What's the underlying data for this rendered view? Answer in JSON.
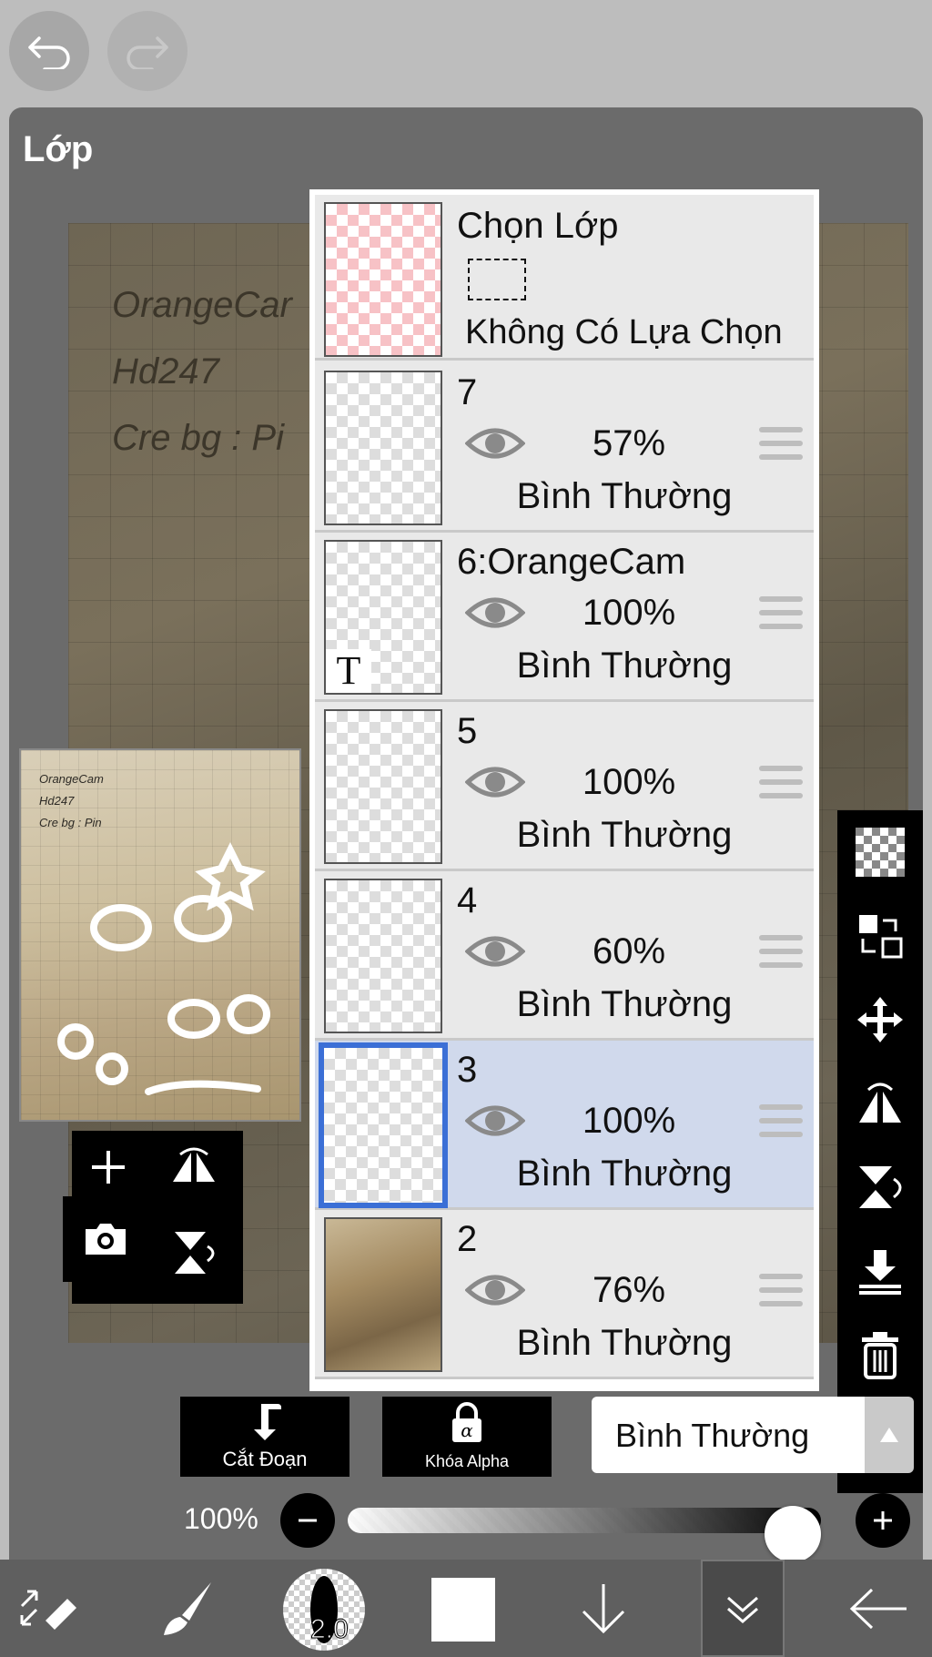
{
  "panel": {
    "title": "Lớp"
  },
  "canvas": {
    "lines": [
      "OrangeCar",
      "Hd247",
      "Cre bg : Pi"
    ]
  },
  "preview": {
    "lines": [
      "OrangeCam",
      "Hd247",
      "Cre bg : Pin"
    ]
  },
  "selection_layer": {
    "title": "Chọn Lớp",
    "status": "Không Có Lựa Chọn"
  },
  "layers": [
    {
      "name": "7",
      "opacity": "57%",
      "blend": "Bình Thường",
      "selected": false
    },
    {
      "name": "6:OrangeCam",
      "opacity": "100%",
      "blend": "Bình Thường",
      "selected": false,
      "thumb_letter": "T"
    },
    {
      "name": "5",
      "opacity": "100%",
      "blend": "Bình Thường",
      "selected": false
    },
    {
      "name": "4",
      "opacity": "60%",
      "blend": "Bình Thường",
      "selected": false
    },
    {
      "name": "3",
      "opacity": "100%",
      "blend": "Bình Thường",
      "selected": true
    },
    {
      "name": "2",
      "opacity": "76%",
      "blend": "Bình Thường",
      "selected": false
    }
  ],
  "bottom_bar": {
    "clip_label": "Cắt Đoạn",
    "alpha_lock_label": "Khóa Alpha",
    "blend_mode": "Bình Thường"
  },
  "opacity_slider": {
    "label": "100%",
    "value": 1.0
  },
  "toolbar": {
    "brush_size": "2.0",
    "color": "#ffffff"
  },
  "colors": {
    "panel_bg": "#6b6b6b",
    "selected_row": "#d0d9ec",
    "selected_border": "#3b6fd6"
  }
}
